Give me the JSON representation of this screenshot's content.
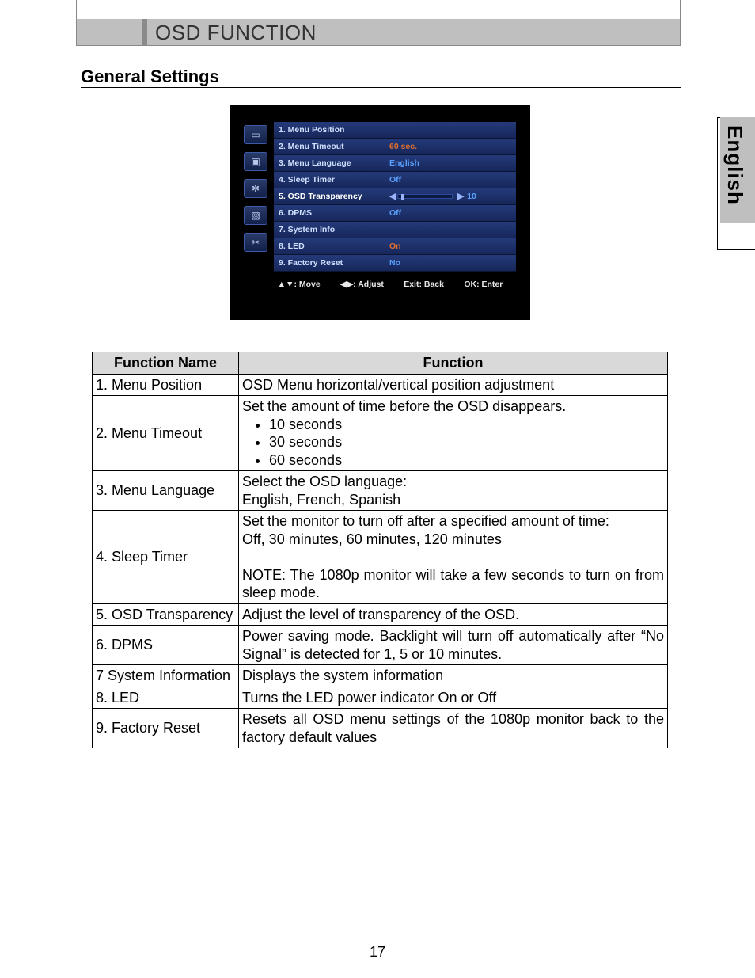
{
  "chapter_title": "OSD FUNCTION",
  "section_heading": "General Settings",
  "language_tab": "English",
  "page_number": "17",
  "osd": {
    "items": [
      {
        "label": "1. Menu Position",
        "value": ""
      },
      {
        "label": "2. Menu Timeout",
        "value": "60 sec.",
        "orange": true
      },
      {
        "label": "3. Menu Language",
        "value": "English"
      },
      {
        "label": "4. Sleep Timer",
        "value": "Off"
      },
      {
        "label": "5. OSD Transparency",
        "value": "10",
        "slider": true,
        "selected": true
      },
      {
        "label": "6. DPMS",
        "value": "Off"
      },
      {
        "label": "7. System Info",
        "value": ""
      },
      {
        "label": "8. LED",
        "value": "On",
        "orange": true
      },
      {
        "label": "9. Factory Reset",
        "value": "No"
      }
    ],
    "hints": {
      "move": "▲▼: Move",
      "adjust": "◀▶: Adjust",
      "back": "Exit: Back",
      "enter": "OK: Enter"
    }
  },
  "table": {
    "head_name": "Function Name",
    "head_func": "Function",
    "rows": {
      "r1": {
        "name": "1. Menu Position",
        "desc": "OSD Menu horizontal/vertical position adjustment"
      },
      "r2": {
        "name": "2. Menu Timeout",
        "intro": "Set the amount of time before the OSD disappears.",
        "b1": "10 seconds",
        "b2": "30 seconds",
        "b3": "60 seconds"
      },
      "r3": {
        "name": "3. Menu Language",
        "l1": "Select the OSD language:",
        "l2": "English, French, Spanish"
      },
      "r4": {
        "name": "4. Sleep Timer",
        "l1": "Set the monitor to turn off after a specified amount of time:",
        "l2": "Off, 30 minutes, 60 minutes, 120 minutes",
        "note": "NOTE: The 1080p monitor will take a few seconds to turn on from sleep mode."
      },
      "r5": {
        "name": "5. OSD Transparency",
        "desc": "Adjust the level of transparency of the OSD."
      },
      "r6": {
        "name": "6. DPMS",
        "desc": "Power saving mode. Backlight will turn off automatically after “No Signal” is detected for 1, 5 or 10 minutes."
      },
      "r7": {
        "name": "7 System Information",
        "desc": "Displays the system information"
      },
      "r8": {
        "name": "8. LED",
        "desc": "Turns the LED power indicator On or Off"
      },
      "r9": {
        "name": "9. Factory Reset",
        "desc": "Resets all OSD menu settings of the 1080p monitor back to the factory default values"
      }
    }
  }
}
